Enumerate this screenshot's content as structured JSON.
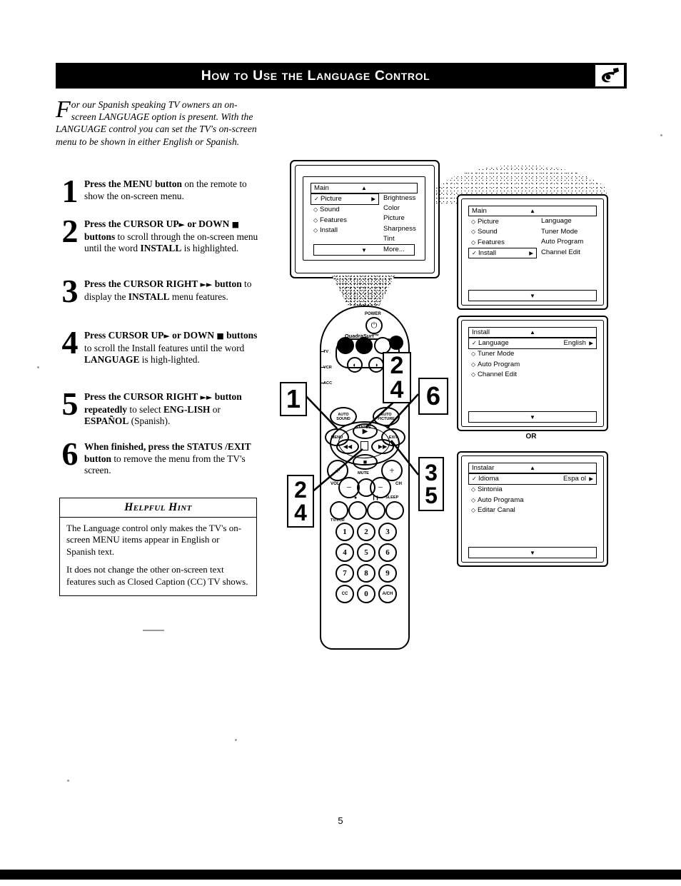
{
  "header": {
    "title": "How to Use the Language Control",
    "logo_icon": "remote-hand-icon"
  },
  "intro": {
    "dropcap": "F",
    "text": "or our Spanish speaking TV owners an on-screen LANGUAGE option is present. With the LANGUAGE control you can set the TV's on-screen menu to be shown in either English or Spanish."
  },
  "steps": [
    {
      "num": "1",
      "html": "<b>Press the MENU button</b> on the remote to show the on-screen menu."
    },
    {
      "num": "2",
      "html": "<b>Press the CURSOR UP<span class=\"gly\">&#9658;</span> or DOWN <span class=\"gly\">&#9632;</span> buttons</b> to scroll through the on-screen menu until the word <b>INSTALL</b> is highlighted."
    },
    {
      "num": "3",
      "html": "<b>Press the CURSOR RIGHT <span class=\"gly\">&#9658;&#9658;</span> button</b> to display the <b>INSTALL</b> menu features."
    },
    {
      "num": "4",
      "html": "<b>Press CURSOR UP<span class=\"gly\">&#9658;</span> or DOWN <span class=\"gly\">&#9632;</span> buttons</b> to scroll the Install features until the word <b>LANGUAGE</b> is high-lighted."
    },
    {
      "num": "5",
      "html": "<b>Press the CURSOR RIGHT <span class=\"gly\">&#9658;&#9658;</span> button repeatedly</b> to select <b>ENG-LISH</b> or <b>ESPA&Ntilde;OL</b> (Spanish)."
    },
    {
      "num": "6",
      "html": "<b>When finished, press the STATUS /EXIT button</b> to remove the menu from the TV's screen."
    }
  ],
  "hint": {
    "title": "Helpful Hint",
    "p1": "The Language control only makes the TV's on-screen MENU items appear in English or Spanish text.",
    "p2": "It does not change the other on-screen text features such as Closed Caption (CC) TV shows."
  },
  "osd_tv": {
    "title": "Main",
    "up_arrow": "▲",
    "down_arrow": "▼",
    "left_items": [
      {
        "label": "Picture",
        "bullet": "✓",
        "selected": true,
        "arrow": "▶"
      },
      {
        "label": "Sound",
        "bullet": "◇",
        "selected": false
      },
      {
        "label": "Features",
        "bullet": "◇",
        "selected": false
      },
      {
        "label": "Install",
        "bullet": "◇",
        "selected": false
      }
    ],
    "right_items": [
      "Brightness",
      "Color",
      "Picture",
      "Sharpness",
      "Tint",
      "More..."
    ]
  },
  "osd_main_install": {
    "title": "Main",
    "up_arrow": "▲",
    "down_arrow": "▼",
    "left_items": [
      {
        "label": "Picture",
        "bullet": "◇",
        "selected": false
      },
      {
        "label": "Sound",
        "bullet": "◇",
        "selected": false
      },
      {
        "label": "Features",
        "bullet": "◇",
        "selected": false
      },
      {
        "label": "Install",
        "bullet": "✓",
        "selected": true,
        "arrow": "▶"
      }
    ],
    "right_items": [
      "Language",
      "Tuner Mode",
      "Auto Program",
      "Channel Edit"
    ]
  },
  "osd_install_english": {
    "title": "Install",
    "up_arrow": "▲",
    "down_arrow": "▼",
    "items": [
      {
        "label": "Language",
        "bullet": "✓",
        "value": "English",
        "arrow": "▶",
        "selected": true
      },
      {
        "label": "Tuner Mode",
        "bullet": "◇",
        "value": "",
        "selected": false
      },
      {
        "label": "Auto Program",
        "bullet": "◇",
        "value": "",
        "selected": false
      },
      {
        "label": "Channel Edit",
        "bullet": "◇",
        "value": "",
        "selected": false
      }
    ]
  },
  "or_label": "OR",
  "osd_install_spanish": {
    "title": "Instalar",
    "up_arrow": "▲",
    "down_arrow": "▼",
    "items": [
      {
        "label": "Idioma",
        "bullet": "✓",
        "value": "Espa ol",
        "arrow": "▶",
        "selected": true
      },
      {
        "label": "Sintonia",
        "bullet": "◇",
        "value": "",
        "selected": false
      },
      {
        "label": "Auto Programa",
        "bullet": "◇",
        "value": "",
        "selected": false
      },
      {
        "label": "Editar Canal",
        "bullet": "◇",
        "value": "",
        "selected": false
      }
    ]
  },
  "remote": {
    "power_label": "POWER",
    "power_icon": "⏻",
    "quadrasurf_label": "QuadraSurf™",
    "source_labels": [
      "TV",
      "VCR",
      "ACC"
    ],
    "auto_sound_label": "AUTO SOUND",
    "auto_picture_label": "AUTO PICTURE",
    "status_label": "STATUS",
    "menu_label": "MENU",
    "exit_label": "EXIT",
    "cursor_up": "▶",
    "cursor_left": "◀◀",
    "cursor_right": "▶▶",
    "cursor_down": "■",
    "vol_label": "VOL",
    "ch_label": "CH",
    "mute_label": "MUTE",
    "plus": "+",
    "minus": "−",
    "sleep_label": "SLEEP",
    "tvvcr_label": "TV/VCR",
    "pause_label": "❙❙",
    "rec_label": "●",
    "keys": [
      "1",
      "2",
      "3",
      "4",
      "5",
      "6",
      "7",
      "8",
      "9",
      "CC",
      "0",
      "A/CH"
    ]
  },
  "callouts": {
    "c1": "1",
    "c24a_top": "2",
    "c24a_bottom": "4",
    "c6": "6",
    "c24b_top": "2",
    "c24b_bottom": "4",
    "c35_top": "3",
    "c35_bottom": "5"
  },
  "footer": {
    "page_number": "5"
  }
}
